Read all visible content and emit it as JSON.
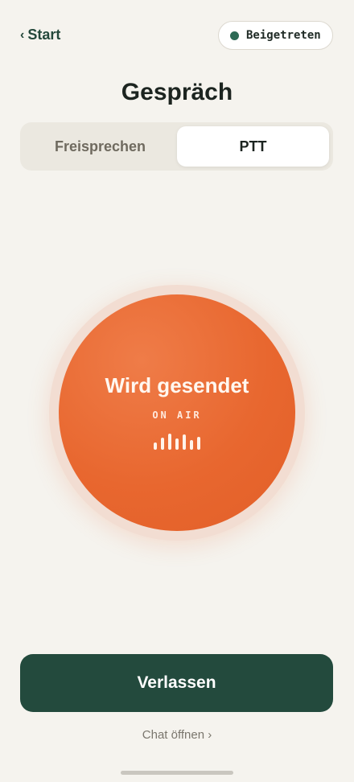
{
  "header": {
    "back_chevron": "‹",
    "back_label": "Start",
    "status_label": "Beigetreten",
    "status_color": "#2d6a55"
  },
  "title": "Gespräch",
  "mode_tabs": {
    "left_label": "Freisprechen",
    "right_label": "PTT",
    "selected": "PTT"
  },
  "ptt": {
    "label": "Wird gesendet",
    "sublabel": "ON AIR",
    "accent_color": "#e8672f",
    "level_bars": [
      0.45,
      0.75,
      1.0,
      0.7,
      0.95,
      0.6,
      0.8
    ]
  },
  "actions": {
    "leave_label": "Verlassen",
    "chat_label": "Chat öffnen ›"
  }
}
